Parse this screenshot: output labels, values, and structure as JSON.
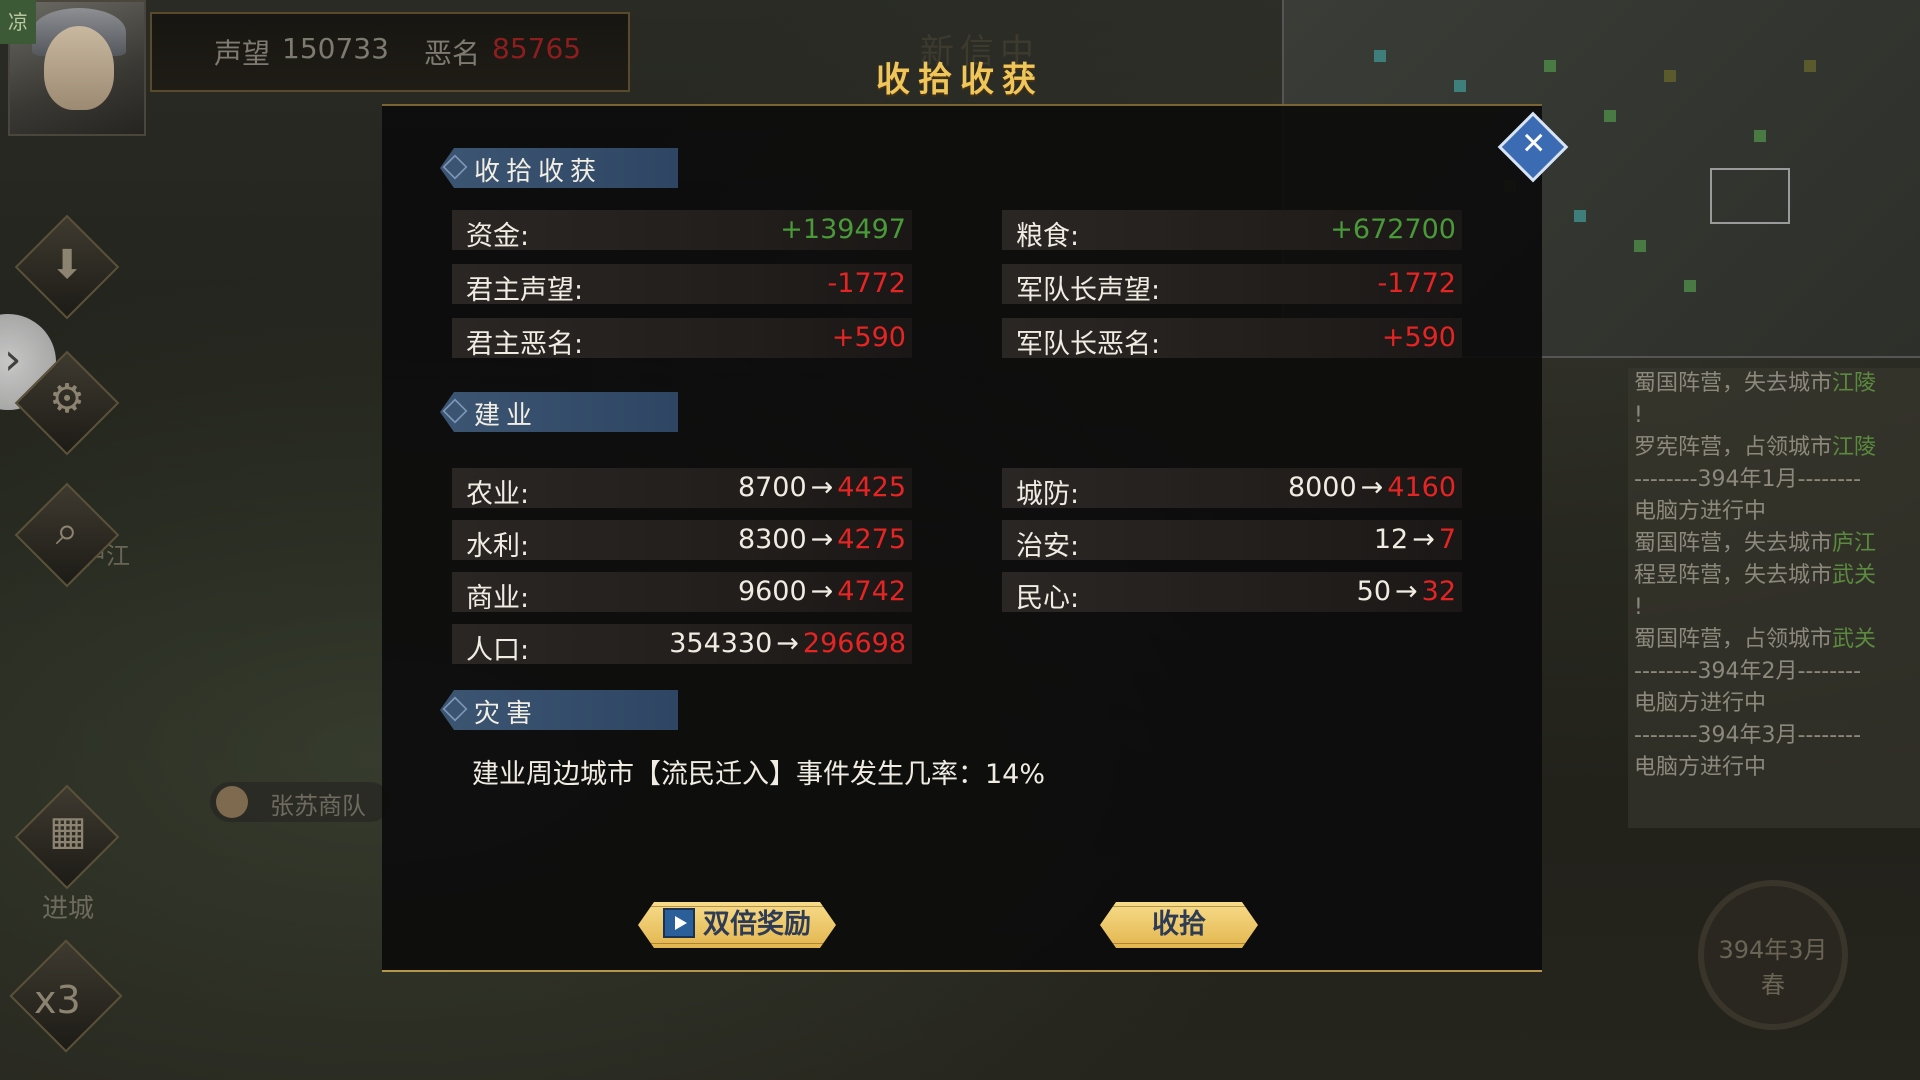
{
  "hud": {
    "faction_tag": "凉",
    "prestige_label": "声望",
    "prestige_value": "150733",
    "infamy_label": "恶名",
    "infamy_value": "85765"
  },
  "map_labels": {
    "city_top": "新信中",
    "city_left": "庐江",
    "caravan": "张苏商队",
    "city_center_ghost": "建业"
  },
  "toolbar": {
    "enter_city_label": "进城",
    "speed_label": "x3"
  },
  "dialog": {
    "title": "收拾收获",
    "sections": {
      "harvest": {
        "title": "收拾收获",
        "left": [
          {
            "label": "资金:",
            "value": "+139497",
            "tone": "green"
          },
          {
            "label": "君主声望:",
            "value": "-1772",
            "tone": "red"
          },
          {
            "label": "君主恶名:",
            "value": "+590",
            "tone": "red"
          }
        ],
        "right": [
          {
            "label": "粮食:",
            "value": "+672700",
            "tone": "green"
          },
          {
            "label": "军队长声望:",
            "value": "-1772",
            "tone": "red"
          },
          {
            "label": "军队长恶名:",
            "value": "+590",
            "tone": "red"
          }
        ]
      },
      "city": {
        "title": "建业",
        "left": [
          {
            "label": "农业:",
            "from": "8700",
            "to": "4425"
          },
          {
            "label": "水利:",
            "from": "8300",
            "to": "4275"
          },
          {
            "label": "商业:",
            "from": "9600",
            "to": "4742"
          },
          {
            "label": "人口:",
            "from": "354330",
            "to": "296698"
          }
        ],
        "right": [
          {
            "label": "城防:",
            "from": "8000",
            "to": "4160"
          },
          {
            "label": "治安:",
            "from": "12",
            "to": "7"
          },
          {
            "label": "民心:",
            "from": "50",
            "to": "32"
          }
        ],
        "arrow": "→"
      },
      "disaster": {
        "title": "灾害",
        "text": "建业周边城市【流民迁入】事件发生几率：14%"
      }
    },
    "buttons": {
      "double_reward": "双倍奖励",
      "collect": "收拾"
    }
  },
  "event_log": [
    {
      "a": "蜀国阵营，失去城市",
      "b": "江陵"
    },
    {
      "a": "!",
      "b": ""
    },
    {
      "a": "罗宪阵营，占领城市",
      "b": "江陵"
    },
    {
      "a": "--------394年1月--------",
      "b": ""
    },
    {
      "a": "电脑方进行中",
      "b": ""
    },
    {
      "a": "蜀国阵营，失去城市",
      "b": "庐江"
    },
    {
      "a": "",
      "b": ""
    },
    {
      "a": "程昱阵营，失去城市",
      "b": "武关"
    },
    {
      "a": "!",
      "b": ""
    },
    {
      "a": "蜀国阵营，占领城市",
      "b": "武关"
    },
    {
      "a": "--------394年2月--------",
      "b": ""
    },
    {
      "a": "电脑方进行中",
      "b": ""
    },
    {
      "a": "--------394年3月--------",
      "b": ""
    },
    {
      "a": "电脑方进行中",
      "b": ""
    }
  ],
  "date": {
    "line1": "394年3月",
    "line2": "春"
  },
  "colors": {
    "accent_gold": "#f0c65a",
    "gain_green": "#4a9a3a",
    "loss_red": "#e52424",
    "section_blue": "#3c5572"
  }
}
